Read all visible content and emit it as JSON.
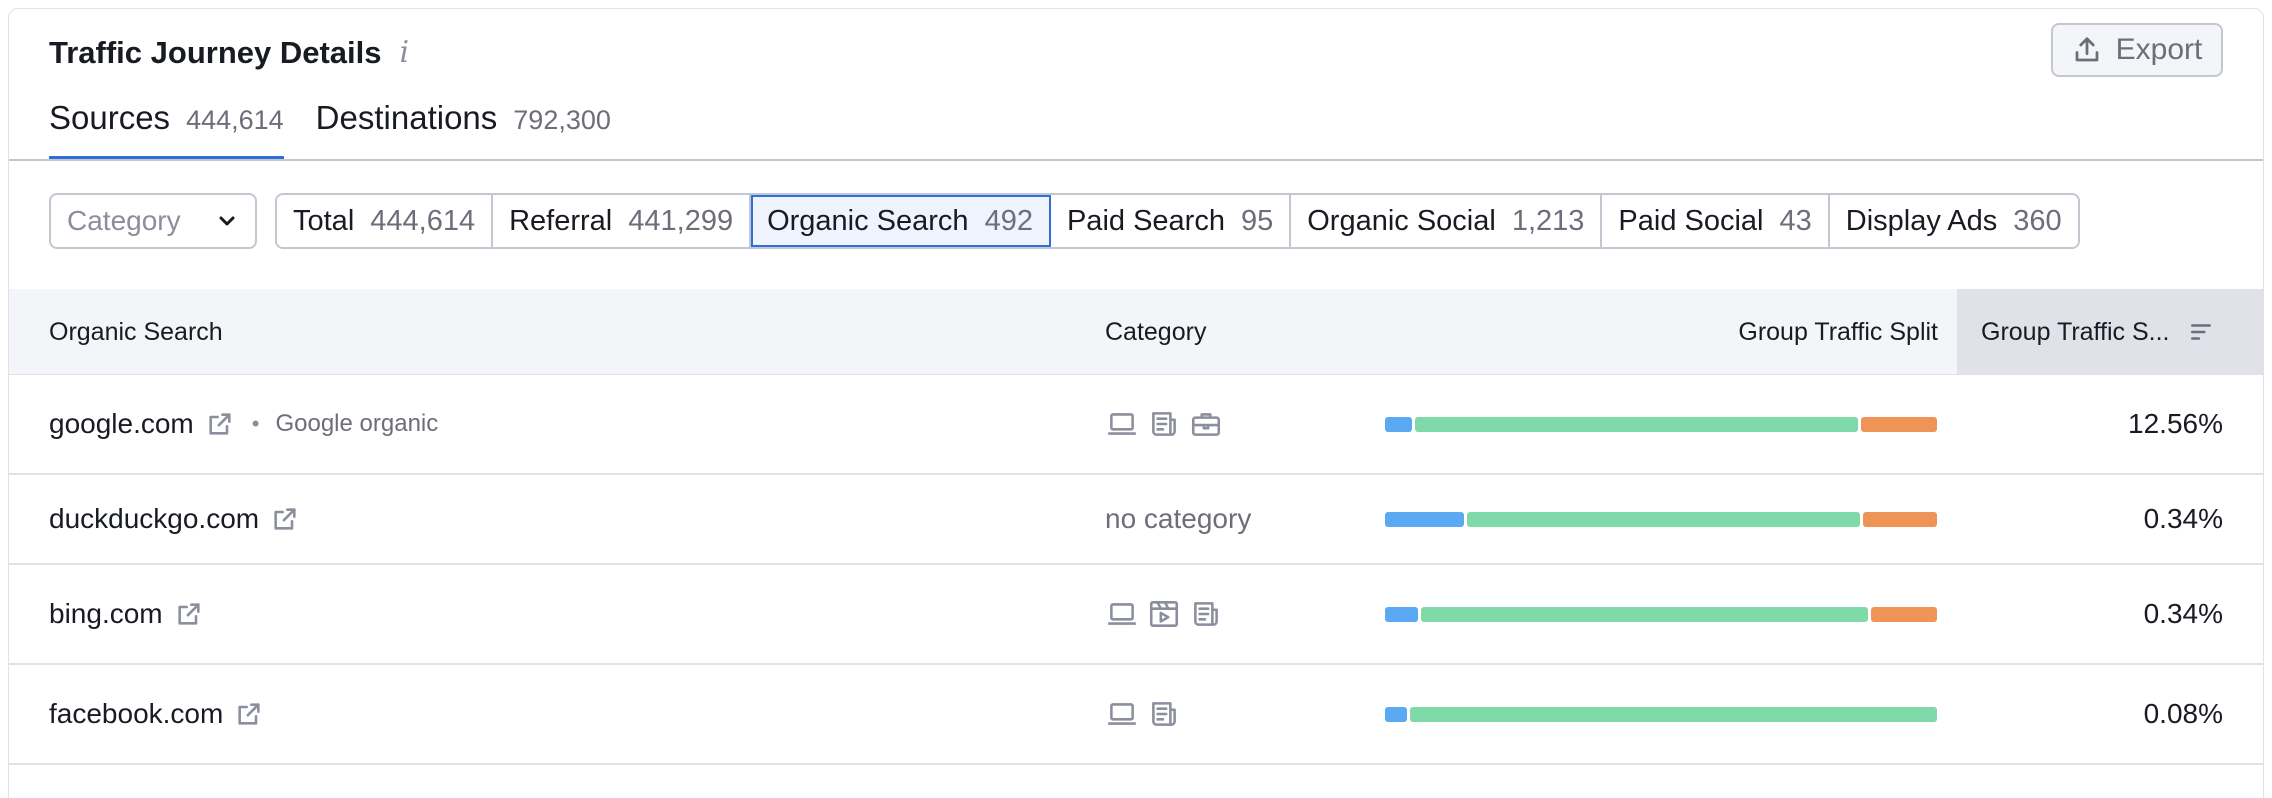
{
  "header": {
    "title": "Traffic Journey Details",
    "info_icon": "i",
    "export_label": "Export"
  },
  "tabs": [
    {
      "label": "Sources",
      "count": "444,614",
      "active": true
    },
    {
      "label": "Destinations",
      "count": "792,300",
      "active": false
    }
  ],
  "filters": {
    "category_placeholder": "Category",
    "segments": [
      {
        "label": "Total",
        "count": "444,614"
      },
      {
        "label": "Referral",
        "count": "441,299"
      },
      {
        "label": "Organic Search",
        "count": "492"
      },
      {
        "label": "Paid Search",
        "count": "95"
      },
      {
        "label": "Organic Social",
        "count": "1,213"
      },
      {
        "label": "Paid Social",
        "count": "43"
      },
      {
        "label": "Display Ads",
        "count": "360"
      }
    ],
    "active_segment": "Organic Search"
  },
  "table": {
    "columns": {
      "name": "Organic Search",
      "category": "Category",
      "split": "Group Traffic Split",
      "share": "Group Traffic S..."
    },
    "rows": [
      {
        "domain": "google.com",
        "sub": "Google organic",
        "category_icons": [
          "laptop-icon",
          "news-icon",
          "briefcase-icon"
        ],
        "category_text": "",
        "split": [
          0.05,
          0.81,
          0.14
        ],
        "share": "12.56%"
      },
      {
        "domain": "duckduckgo.com",
        "sub": "",
        "category_icons": [],
        "category_text": "no category",
        "split": [
          0.145,
          0.72,
          0.135
        ],
        "share": "0.34%"
      },
      {
        "domain": "bing.com",
        "sub": "",
        "category_icons": [
          "laptop-icon",
          "video-icon",
          "news-icon"
        ],
        "category_text": "",
        "split": [
          0.06,
          0.82,
          0.12
        ],
        "share": "0.34%"
      },
      {
        "domain": "facebook.com",
        "sub": "",
        "category_icons": [
          "laptop-icon",
          "news-icon"
        ],
        "category_text": "",
        "split": [
          0.04,
          0.96,
          0.0
        ],
        "share": "0.08%"
      }
    ]
  },
  "colors": {
    "accent": "#2f6fd7",
    "bar_blue": "#5ba9f2",
    "bar_green": "#7fd9a8",
    "bar_orange": "#ee9456"
  }
}
